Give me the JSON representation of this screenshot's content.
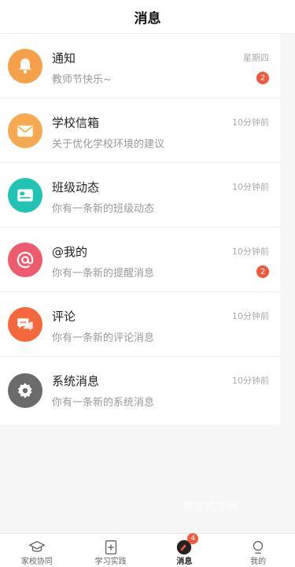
{
  "header": {
    "title": "消息"
  },
  "messages": [
    {
      "title": "通知",
      "subtitle": "教师节快乐~",
      "time": "星期四",
      "badge": "2",
      "icon": "bell-icon",
      "color": "#f6a04c"
    },
    {
      "title": "学校信箱",
      "subtitle": "关于优化学校环境的建议",
      "time": "10分钟前",
      "badge": "",
      "icon": "mail-icon",
      "color": "#f7a94f"
    },
    {
      "title": "班级动态",
      "subtitle": "你有一条新的班级动态",
      "time": "10分钟前",
      "badge": "",
      "icon": "id-card-icon",
      "color": "#21c4b4"
    },
    {
      "title": "@我的",
      "subtitle": "你有一条新的提醒消息",
      "time": "10分钟前",
      "badge": "2",
      "icon": "at-icon",
      "color": "#ee5b6e"
    },
    {
      "title": "评论",
      "subtitle": "你有一条新的评论消息",
      "time": "10分钟前",
      "badge": "",
      "icon": "comment-icon",
      "color": "#f4683c"
    },
    {
      "title": "系统消息",
      "subtitle": "你有一条新的系统消息",
      "time": "10分钟前",
      "badge": "",
      "icon": "gear-icon",
      "color": "#6b6b6b"
    }
  ],
  "watermark": "微志成学网",
  "tabs": [
    {
      "label": "家校协同",
      "icon": "graduation-cap-icon",
      "active": false
    },
    {
      "label": "学习实践",
      "icon": "add-note-icon",
      "active": false
    },
    {
      "label": "消息",
      "icon": "message-icon",
      "active": true,
      "badge": "4"
    },
    {
      "label": "我的",
      "icon": "user-icon",
      "active": false
    }
  ]
}
